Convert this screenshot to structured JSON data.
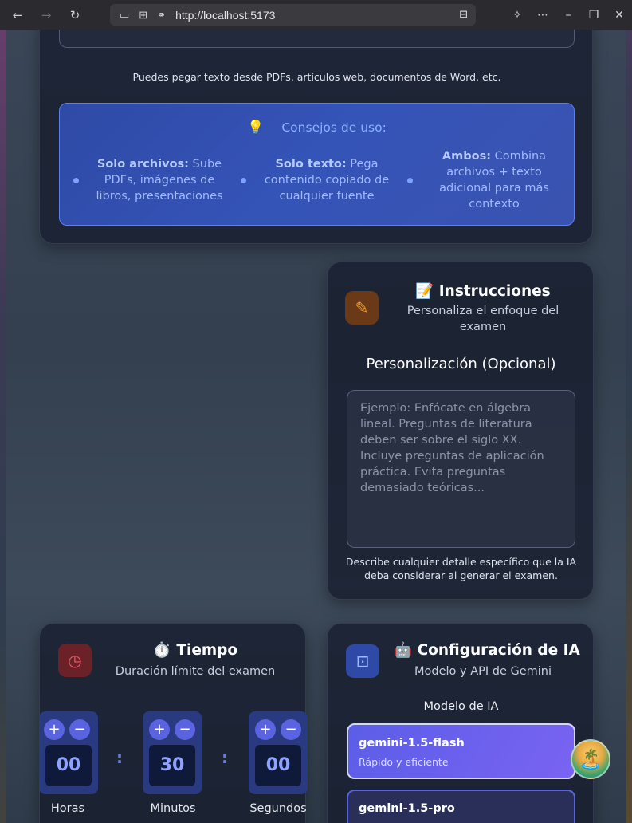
{
  "browser": {
    "url": "http://localhost:5173",
    "back_icon": "←",
    "forward_icon": "→",
    "reload_icon": "↻"
  },
  "upload": {
    "hint": "Puedes pegar texto desde PDFs, artículos web, documentos de Word, etc."
  },
  "tips": {
    "title": "Consejos de uso:",
    "items": [
      {
        "bold": "Solo archivos:",
        "text": " Sube PDFs, imágenes de libros, presentaciones"
      },
      {
        "bold": "Solo texto:",
        "text": " Pega contenido copiado de cualquier fuente"
      },
      {
        "bold": "Ambos:",
        "text": " Combina archivos + texto adicional para más contexto"
      }
    ]
  },
  "instructions": {
    "title": "📝 Instrucciones",
    "subtitle": "Personaliza el enfoque del examen",
    "section_label": "Personalización (Opcional)",
    "placeholder": "Ejemplo: Enfócate en álgebra lineal. Preguntas de literatura deben ser sobre el siglo XX. Incluye preguntas de aplicación práctica. Evita preguntas demasiado teóricas...",
    "help": "Describe cualquier detalle específico que la IA deba considerar al generar el examen."
  },
  "time": {
    "title": "⏱️ Tiempo",
    "subtitle": "Duración límite del examen",
    "units": [
      {
        "label": "Horas",
        "value": "00"
      },
      {
        "label": "Minutos",
        "value": "30"
      },
      {
        "label": "Segundos",
        "value": "00"
      }
    ],
    "plus": "+",
    "minus": "−",
    "separator": ":"
  },
  "ai": {
    "title": "🤖 Configuración de IA",
    "subtitle": "Modelo y API de Gemini",
    "model_label": "Modelo de IA",
    "models": [
      {
        "name": "gemini-1.5-flash",
        "desc": "Rápido y eficiente",
        "selected": true
      },
      {
        "name": "gemini-1.5-pro",
        "desc": "",
        "selected": false
      }
    ]
  },
  "fab": {
    "icon": "🏝️"
  }
}
